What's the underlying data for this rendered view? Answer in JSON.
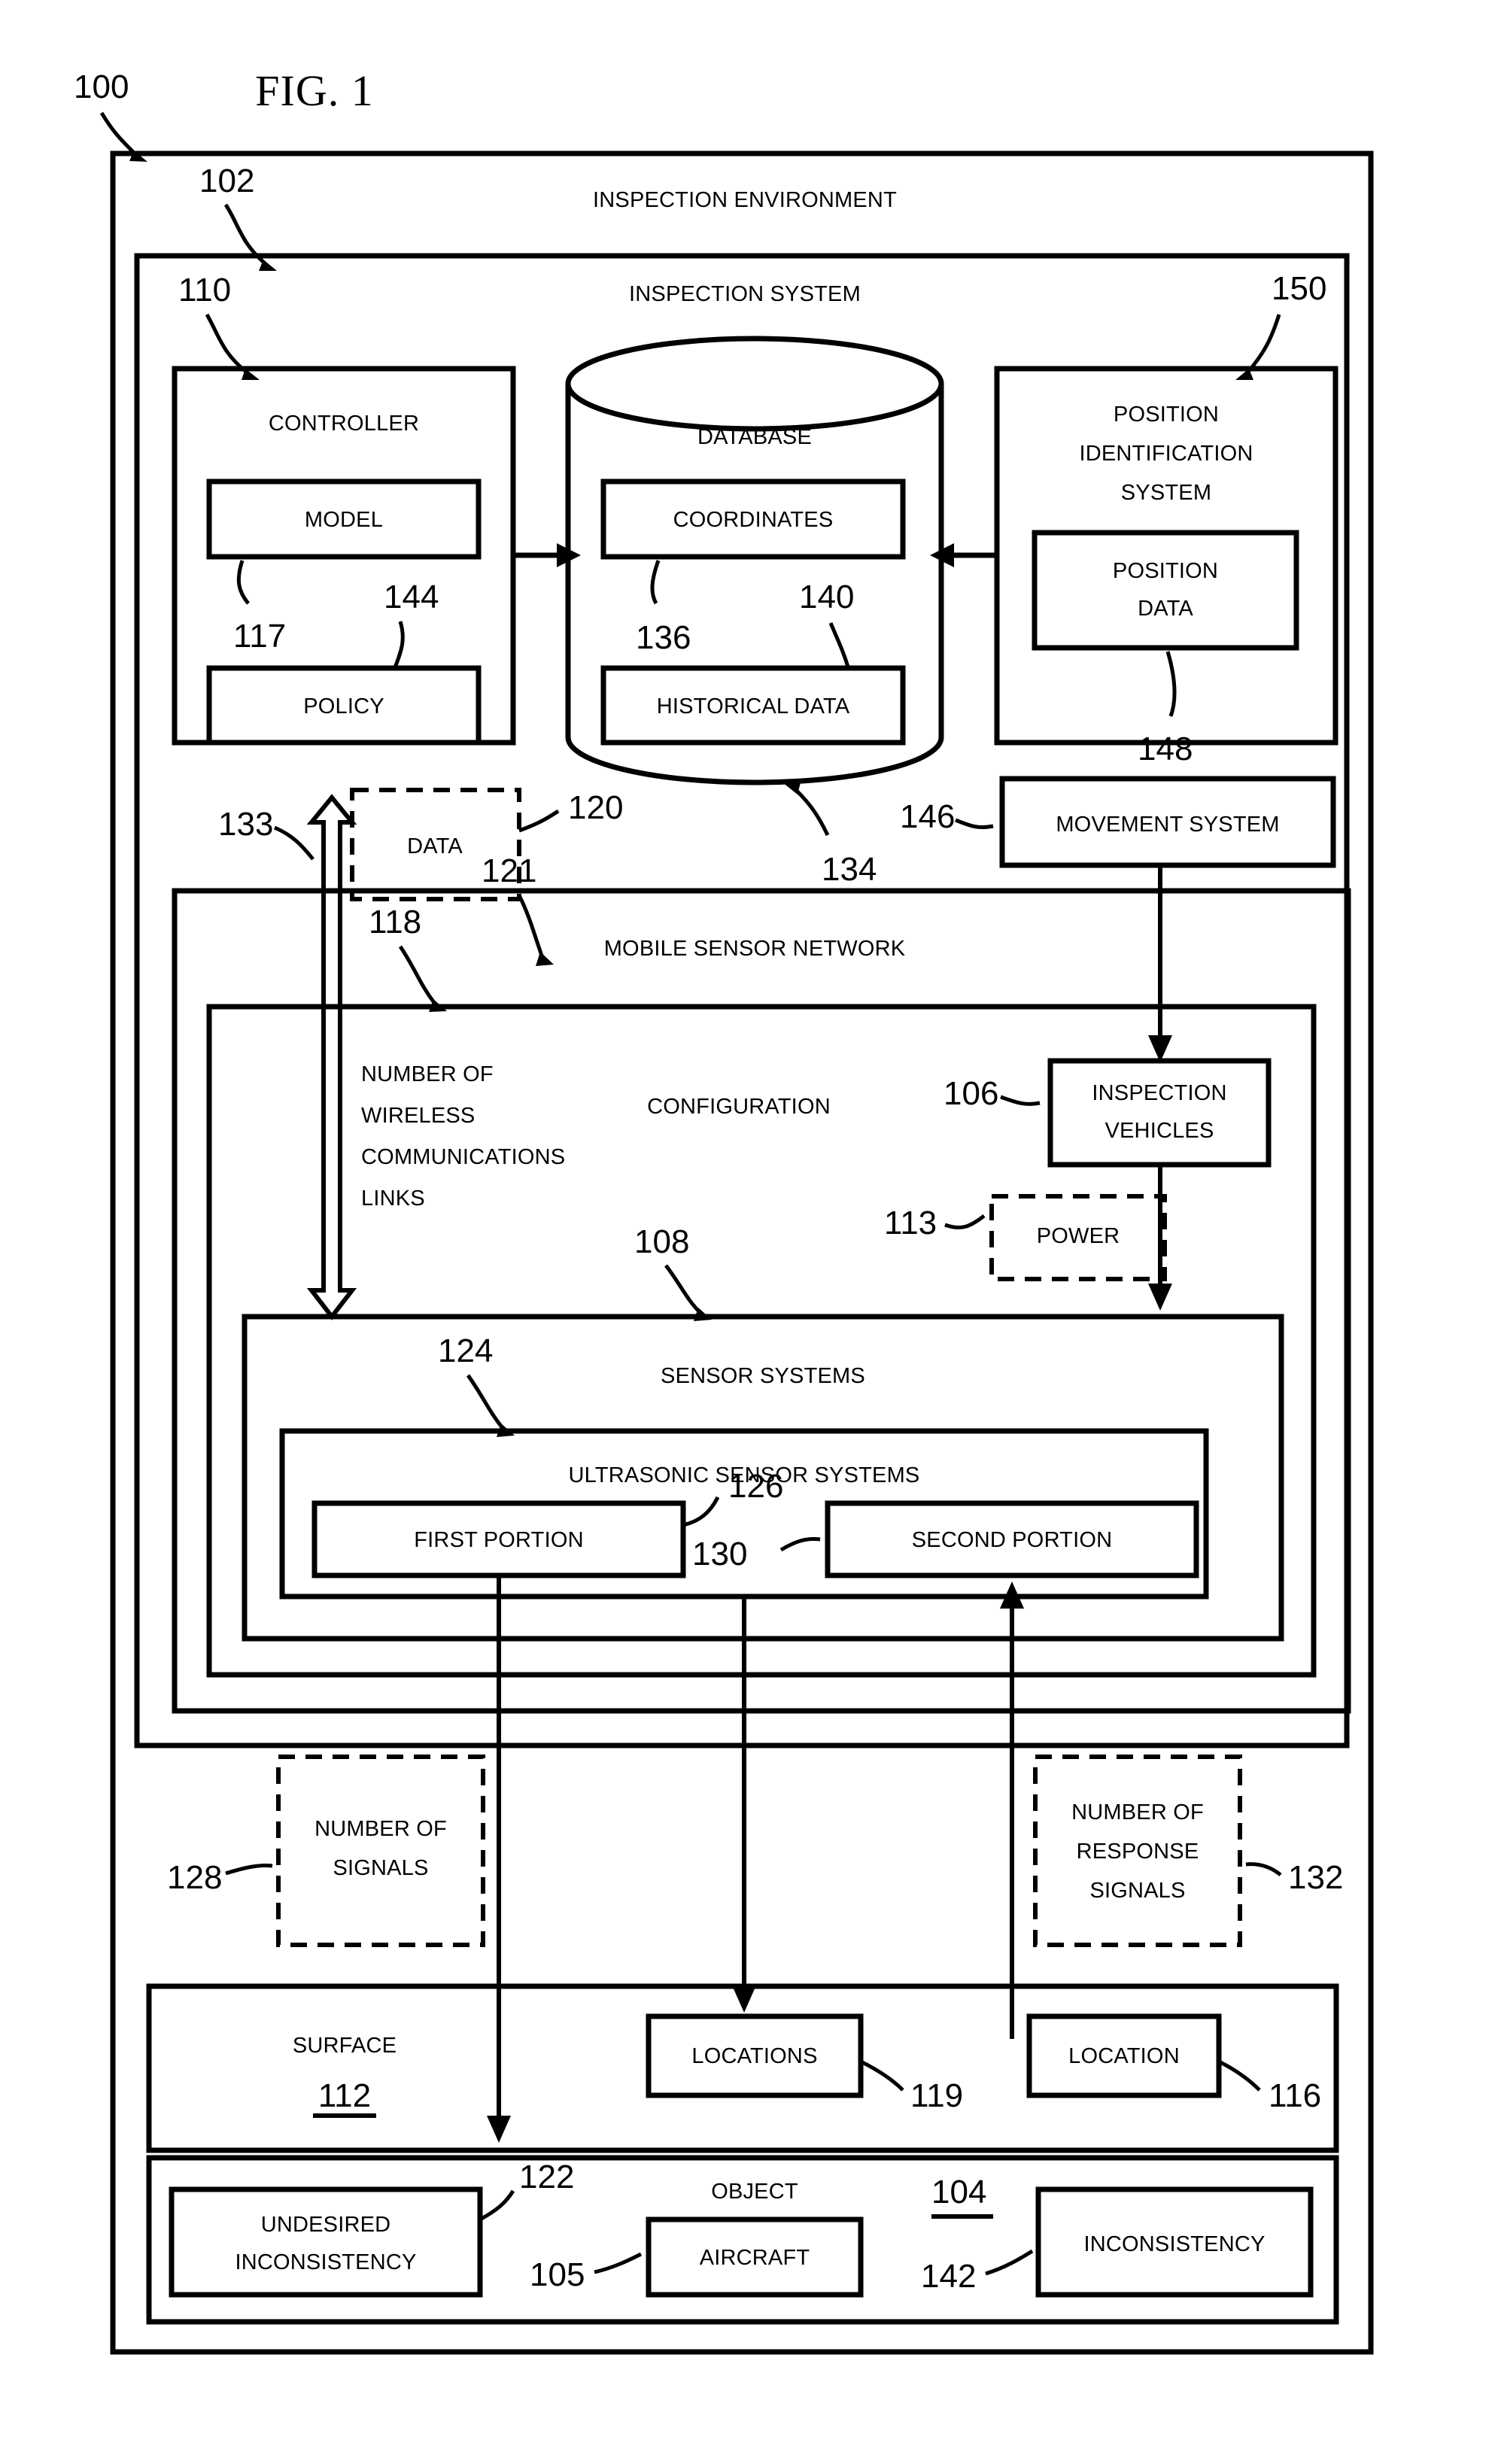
{
  "figure": {
    "title": "FIG. 1",
    "root_ref": "100"
  },
  "boxes": {
    "inspection_environment": {
      "label": "INSPECTION ENVIRONMENT",
      "ref": "102"
    },
    "inspection_system": {
      "label": "INSPECTION SYSTEM",
      "ref": "110_left_ref"
    },
    "controller": {
      "label": "CONTROLLER",
      "ref": "110"
    },
    "model": {
      "label": "MODEL",
      "ref": "117"
    },
    "policy": {
      "label": "POLICY",
      "ref": "144"
    },
    "database": {
      "label": "DATABASE",
      "ref": "134"
    },
    "coordinates": {
      "label": "COORDINATES",
      "ref": "136"
    },
    "historical_data": {
      "label": "HISTORICAL DATA",
      "ref": "140"
    },
    "position_identification_system": {
      "label_line1": "POSITION",
      "label_line2": "IDENTIFICATION",
      "label_line3": "SYSTEM",
      "ref": "150"
    },
    "position_data": {
      "label_line1": "POSITION",
      "label_line2": "DATA",
      "ref": "148"
    },
    "data": {
      "label": "DATA",
      "ref": "120"
    },
    "movement_system": {
      "label": "MOVEMENT SYSTEM",
      "ref": "146"
    },
    "mobile_sensor_network": {
      "label": "MOBILE SENSOR NETWORK",
      "ref": "121"
    },
    "configuration": {
      "label": "CONFIGURATION",
      "ref": "118"
    },
    "wireless_links": {
      "line1": "NUMBER OF",
      "line2": "WIRELESS",
      "line3": "COMMUNICATIONS",
      "line4": "LINKS",
      "ref": "133"
    },
    "inspection_vehicles": {
      "label_line1": "INSPECTION",
      "label_line2": "VEHICLES",
      "ref": "106"
    },
    "power": {
      "label": "POWER",
      "ref": "113"
    },
    "sensor_systems": {
      "label": "SENSOR SYSTEMS",
      "ref": "108"
    },
    "ultrasonic_sensor_systems": {
      "label": "ULTRASONIC SENSOR SYSTEMS",
      "ref": "124"
    },
    "first_portion": {
      "label": "FIRST PORTION",
      "ref": "126"
    },
    "second_portion": {
      "label": "SECOND PORTION",
      "ref": "130"
    },
    "number_of_signals": {
      "line1": "NUMBER OF",
      "line2": "SIGNALS",
      "ref": "128"
    },
    "number_of_response_signals": {
      "line1": "NUMBER OF",
      "line2": "RESPONSE",
      "line3": "SIGNALS",
      "ref": "132"
    },
    "surface": {
      "label": "SURFACE",
      "ref": "112"
    },
    "locations": {
      "label": "LOCATIONS",
      "ref": "119"
    },
    "location": {
      "label": "LOCATION",
      "ref": "116"
    },
    "object": {
      "label": "OBJECT",
      "ref": "104"
    },
    "undesired_inconsistency": {
      "line1": "UNDESIRED",
      "line2": "INCONSISTENCY",
      "ref": "122"
    },
    "aircraft": {
      "label": "AIRCRAFT",
      "ref": "105"
    },
    "inconsistency": {
      "label": "INCONSISTENCY",
      "ref": "142"
    }
  },
  "reference_numerals": [
    "100",
    "102",
    "104",
    "105",
    "106",
    "108",
    "110",
    "112",
    "113",
    "116",
    "117",
    "118",
    "119",
    "120",
    "121",
    "122",
    "124",
    "126",
    "128",
    "130",
    "132",
    "133",
    "134",
    "136",
    "140",
    "142",
    "144",
    "146",
    "148",
    "150"
  ],
  "colors": {
    "stroke": "#000000",
    "background": "#ffffff"
  }
}
